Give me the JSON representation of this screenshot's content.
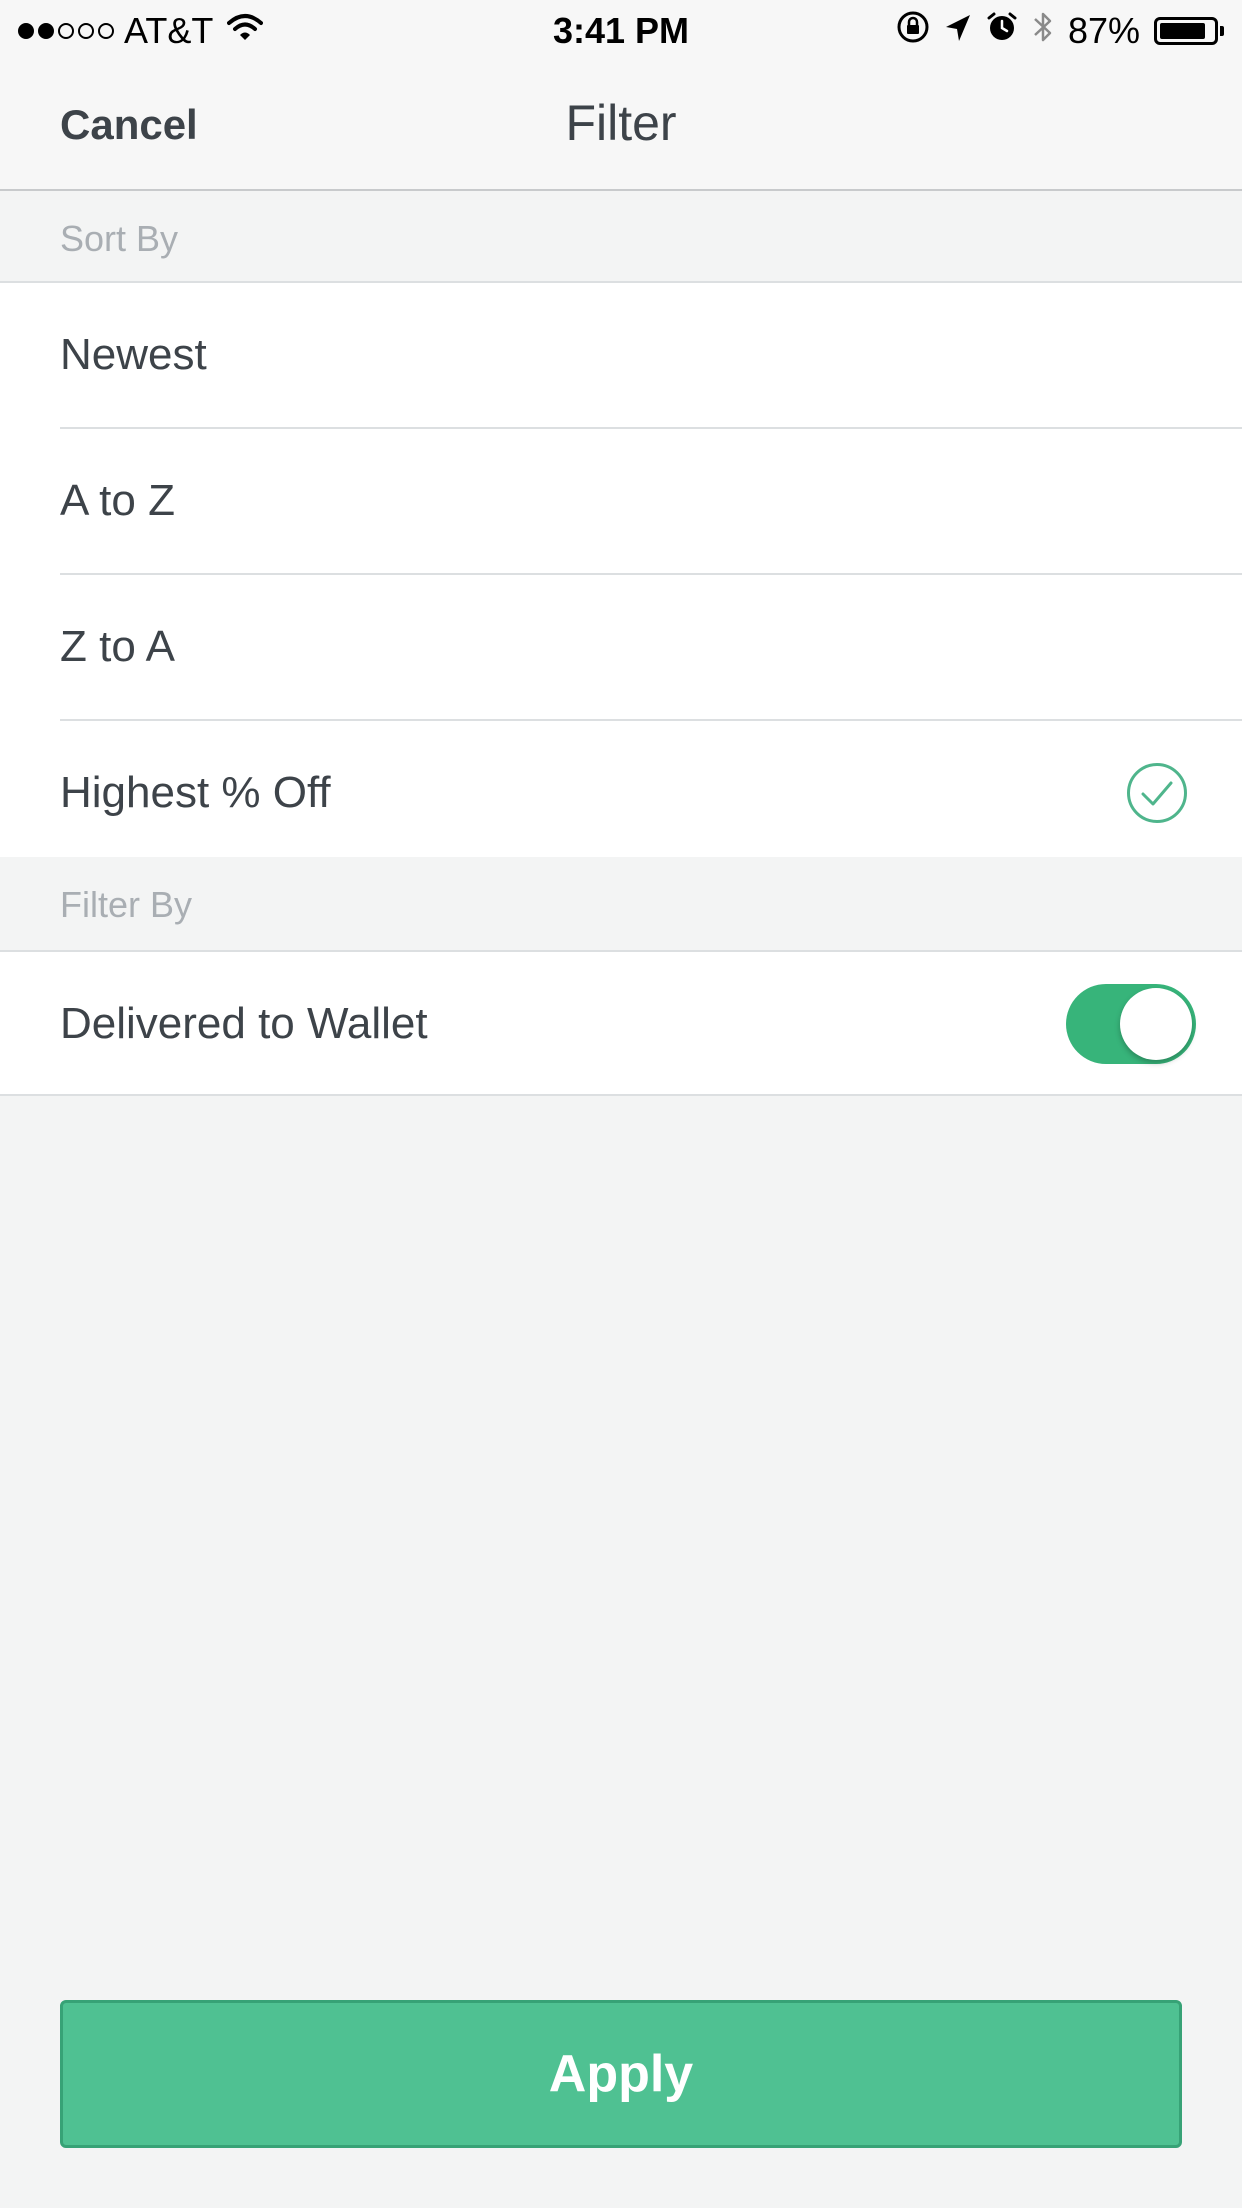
{
  "status_bar": {
    "carrier": "AT&T",
    "signal_bars_filled": 2,
    "signal_bars_total": 5,
    "time": "3:41 PM",
    "battery_percent": "87%",
    "battery_level": 0.87,
    "icons": [
      "signal-dots-icon",
      "wifi-icon",
      "rotation-lock-icon",
      "location-arrow-icon",
      "alarm-icon",
      "bluetooth-icon",
      "battery-icon"
    ]
  },
  "nav": {
    "cancel_label": "Cancel",
    "title": "Filter"
  },
  "sort_section": {
    "header": "Sort By",
    "options": [
      {
        "label": "Newest",
        "selected": false
      },
      {
        "label": "A to Z",
        "selected": false
      },
      {
        "label": "Z to A",
        "selected": false
      },
      {
        "label": "Highest % Off",
        "selected": true
      }
    ]
  },
  "filter_section": {
    "header": "Filter By",
    "options": [
      {
        "label": "Delivered to Wallet",
        "enabled": true
      }
    ]
  },
  "apply_label": "Apply",
  "colors": {
    "accent": "#4fc192",
    "toggle_on": "#37b47a",
    "check": "#4fb58c"
  }
}
